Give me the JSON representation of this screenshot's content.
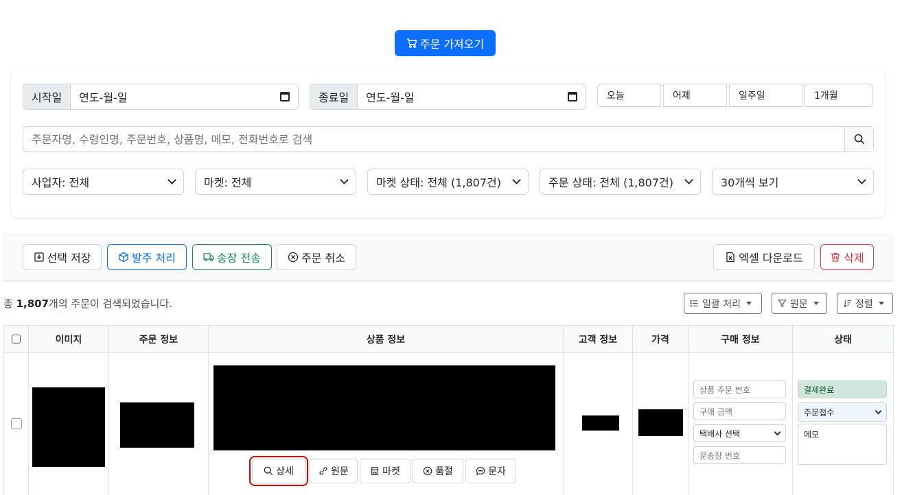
{
  "header": {
    "fetch_orders_label": "주문 가져오기"
  },
  "filters": {
    "start_label": "시작일",
    "start_value": "연도-월-일",
    "end_label": "종료일",
    "end_value": "연도-월-일",
    "quick": [
      "오늘",
      "어제",
      "일주일",
      "1개월"
    ],
    "search_placeholder": "주문자명, 수령인명, 주문번호, 상품명, 메모, 전화번호로 검색",
    "selects": [
      "사업자: 전체",
      "마켓: 전체",
      "마켓 상태: 전체 (1,807건)",
      "주문 상태: 전체 (1,807건)",
      "30개씩 보기"
    ]
  },
  "toolbar": {
    "save_selected": "선택 저장",
    "process_order": "발주 처리",
    "send_invoice": "송장 전송",
    "cancel_order": "주문 취소",
    "excel_download": "엑셀 다운로드",
    "delete": "삭제"
  },
  "summary": {
    "prefix": "총 ",
    "count": "1,807",
    "suffix": "개의 주문이 검색되었습니다."
  },
  "dropdowns": {
    "bulk": "일괄 처리",
    "source": "원문",
    "sort": "정렬"
  },
  "table": {
    "headers": [
      "이미지",
      "주문 정보",
      "상품 정보",
      "고객 정보",
      "가격",
      "구매 정보",
      "상태"
    ],
    "row": {
      "actions": [
        "상세",
        "원문",
        "마켓",
        "품절",
        "문자"
      ],
      "purchase": {
        "product_order_no": "상품 주문 번호",
        "purchase_amount": "구매 금액",
        "courier": "택배사 선택",
        "tracking_no": "운송장 번호"
      },
      "status": {
        "payment": "결제완료",
        "order_status": "주문접수",
        "memo": "메모"
      }
    }
  },
  "colors": {
    "primary": "#0d6efd",
    "success": "#198754",
    "danger": "#dc3545",
    "highlight": "#e00000"
  }
}
